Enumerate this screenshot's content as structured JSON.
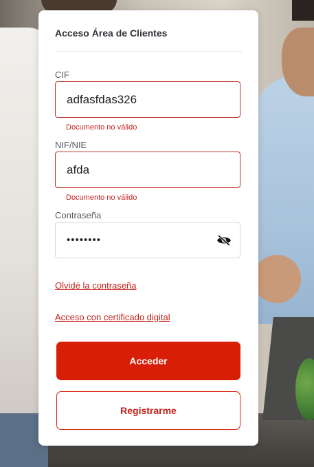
{
  "card": {
    "title": "Acceso Área de Clientes"
  },
  "cif": {
    "label": "CIF",
    "value": "adfasfdas326",
    "error": "Documento no válido"
  },
  "nif": {
    "label": "NIF/NIE",
    "value": "afda",
    "error": "Documento no válido"
  },
  "password": {
    "label": "Contraseña",
    "value": "12345678",
    "icon": "eye-slash-icon"
  },
  "links": {
    "forgot": "Olvidé la contraseña",
    "certificate": "Acceso con certificado digital"
  },
  "buttons": {
    "login": "Acceder",
    "register": "Registrarme"
  },
  "colors": {
    "accent": "#d81e06",
    "error": "#c4221a"
  }
}
